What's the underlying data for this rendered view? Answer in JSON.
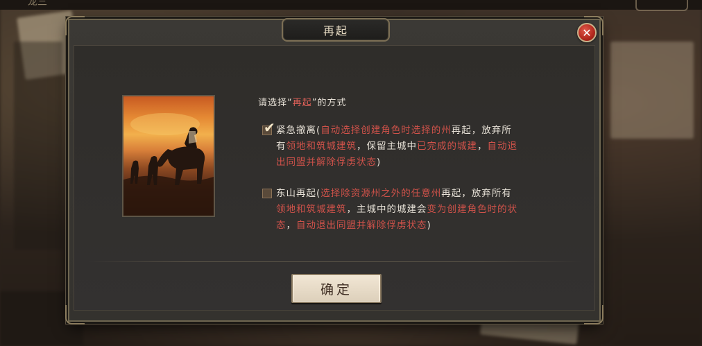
{
  "topbar": {
    "left_text": "龙三",
    "right_text": ""
  },
  "dialog": {
    "title": "再起",
    "prompt_prefix": "请选择“",
    "prompt_highlight": "再起",
    "prompt_suffix": "”的方式",
    "options": [
      {
        "checked": true,
        "name": "紧急撤离",
        "paren_open": "(",
        "line_segments": [
          {
            "t": "自动选择创建角色时选择的州",
            "red": true
          },
          {
            "t": "再起，放弃所有",
            "red": false
          },
          {
            "t": "领地和筑城建筑",
            "red": true
          },
          {
            "t": "，保留主城中",
            "red": false
          },
          {
            "t": "已完成的城建",
            "red": true
          },
          {
            "t": "，",
            "red": false
          },
          {
            "t": "自动退出同盟并解除俘虏状态",
            "red": true
          }
        ],
        "paren_close": ")"
      },
      {
        "checked": false,
        "name": "东山再起",
        "paren_open": "(",
        "line_segments": [
          {
            "t": "选择除资源州之外的任意州",
            "red": true
          },
          {
            "t": "再起，放弃所有",
            "red": false
          },
          {
            "t": "领地和筑城建筑",
            "red": true
          },
          {
            "t": "，主城中的城建会",
            "red": false
          },
          {
            "t": "变为创建角色时的状态",
            "red": true
          },
          {
            "t": "，",
            "red": false
          },
          {
            "t": "自动退出同盟并解除俘虏状态",
            "red": true
          }
        ],
        "paren_close": ")"
      }
    ],
    "confirm_label": "确定",
    "close_icon": "close-x-icon"
  },
  "colors": {
    "accent_red": "#d0524a",
    "text_light": "#e6e0d6",
    "button_bg": "#ddd0bb"
  }
}
